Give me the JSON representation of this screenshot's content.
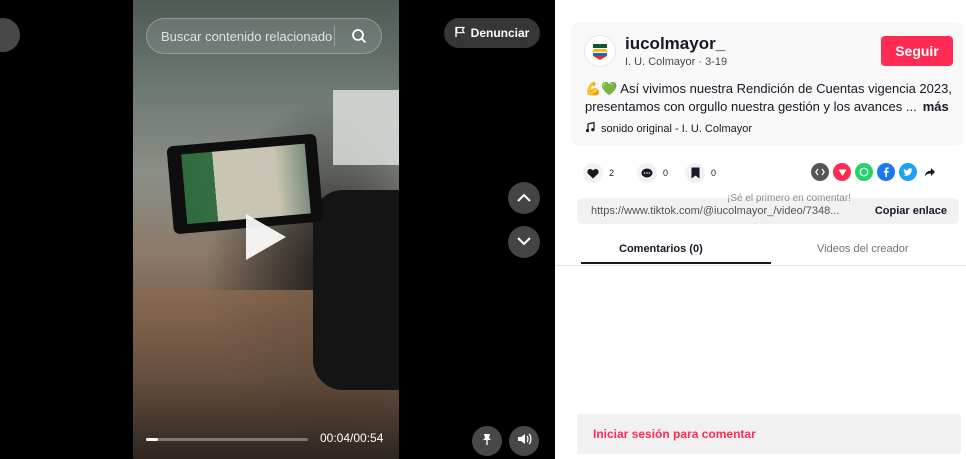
{
  "video": {
    "search_placeholder": "Buscar contenido relacionado",
    "report_label": "Denunciar",
    "time": "00:04/00:54",
    "progress_percent": 7.4
  },
  "author": {
    "username": "iucolmayor_",
    "meta": "I. U. Colmayor · 3-19",
    "follow_label": "Seguir",
    "description": "💪💚 Así vivimos nuestra Rendición de Cuentas vigencia 2023, presentamos con orgullo nuestra gestión y los avances ...",
    "more_label": "más",
    "sound": "sonido original - I. U. Colmayor"
  },
  "stats": {
    "likes": "2",
    "comments": "0",
    "saves": "0"
  },
  "share": {
    "url": "https://www.tiktok.com/@iucolmayor_/video/7348...",
    "hint": "¡Sé el primero en comentar!",
    "copy_label": "Copiar enlace",
    "icons": [
      "embed-icon",
      "send-icon",
      "whatsapp-icon",
      "facebook-icon",
      "twitter-icon",
      "share-arrow-icon"
    ]
  },
  "tabs": {
    "comments": "Comentarios (0)",
    "creator_videos": "Videos del creador"
  },
  "comments": {
    "login_prompt": "Iniciar sesión para comentar"
  },
  "colors": {
    "accent": "#fe2c55",
    "text": "#161823"
  }
}
